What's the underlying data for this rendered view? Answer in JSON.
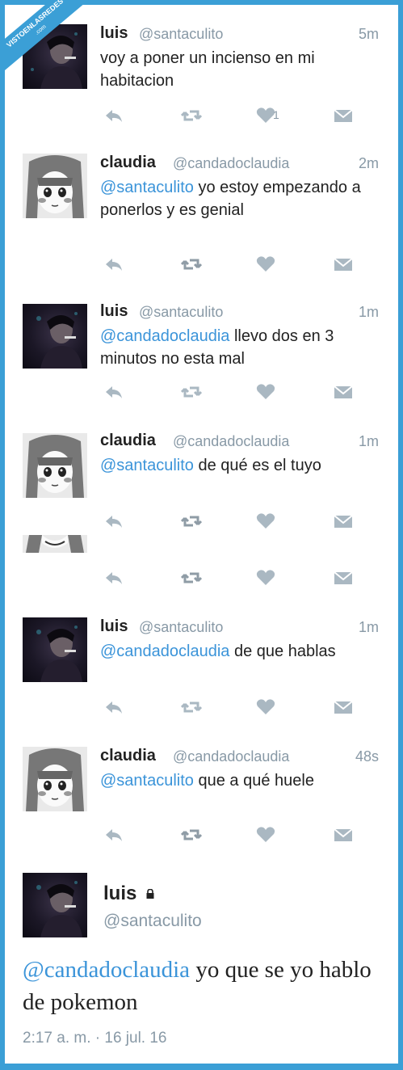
{
  "watermark": {
    "line1": "VISTOENLASREDES",
    "line2": ".com"
  },
  "tweets": [
    {
      "name": "luis",
      "handle": "@santaculito",
      "time": "5m",
      "mention": "",
      "text": "voy a poner un incienso en mi habitacion",
      "like_count": "1",
      "avatar": "luis"
    },
    {
      "name": "claudia",
      "handle": "@candadoclaudia",
      "time": "2m",
      "mention": "@santaculito",
      "text": " yo estoy empezando a ponerlos y es genial",
      "like_count": "",
      "avatar": "claudia"
    },
    {
      "name": "luis",
      "handle": "@santaculito",
      "time": "1m",
      "mention": "@candadoclaudia",
      "text": " llevo dos en 3 minutos no esta mal",
      "like_count": "",
      "avatar": "luis"
    },
    {
      "name": "claudia",
      "handle": "@candadoclaudia",
      "time": "1m",
      "mention": "@santaculito",
      "text": " de qué es el tuyo",
      "like_count": "",
      "avatar": "claudia"
    },
    {
      "name": "luis",
      "handle": "@santaculito",
      "time": "1m",
      "mention": "@candadoclaudia",
      "text": " de que hablas",
      "like_count": "",
      "avatar": "luis"
    },
    {
      "name": "claudia",
      "handle": "@candadoclaudia",
      "time": "48s",
      "mention": "@santaculito",
      "text": " que a qué huele",
      "like_count": "",
      "avatar": "claudia"
    }
  ],
  "action_icons": [
    "reply-icon",
    "retweet-icon",
    "like-icon",
    "dm-icon"
  ],
  "main_tweet": {
    "name": "luis",
    "handle": "@santaculito",
    "mention": "@candadoclaudia",
    "text": " yo que se yo hablo de pokemon",
    "date": "2:17 a. m. · 16 jul. 16"
  },
  "colors": {
    "accent": "#3b9fd6",
    "mention": "#3b94d9",
    "muted": "#8899a6",
    "text": "#222222"
  }
}
